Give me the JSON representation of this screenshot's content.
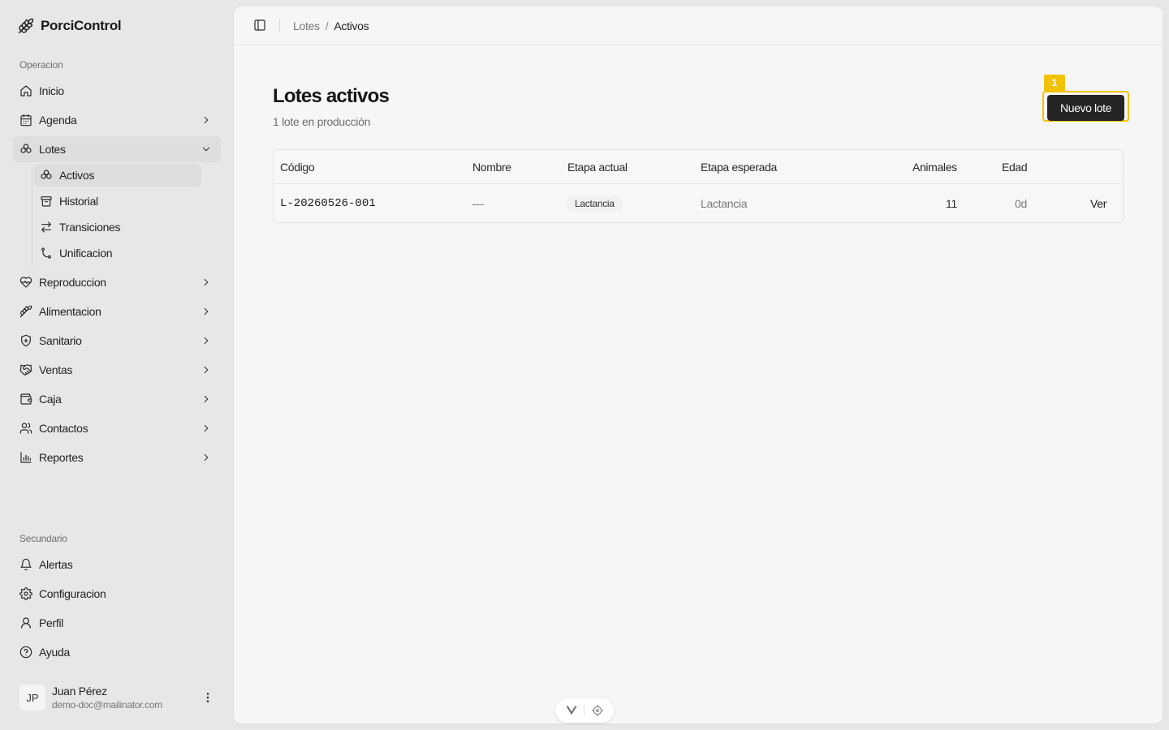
{
  "app": {
    "name": "PorciControl"
  },
  "sidebar": {
    "section_primary": "Operacion",
    "items": [
      {
        "label": "Inicio",
        "icon": "home-icon"
      },
      {
        "label": "Agenda",
        "icon": "calendar-icon"
      },
      {
        "label": "Lotes",
        "icon": "pigs-icon",
        "expanded": true
      },
      {
        "label": "Reproduccion",
        "icon": "heart-pulse-icon"
      },
      {
        "label": "Alimentacion",
        "icon": "wheat-icon"
      },
      {
        "label": "Sanitario",
        "icon": "shield-icon"
      },
      {
        "label": "Ventas",
        "icon": "handshake-icon"
      },
      {
        "label": "Caja",
        "icon": "wallet-icon"
      },
      {
        "label": "Contactos",
        "icon": "users-icon"
      },
      {
        "label": "Reportes",
        "icon": "bar-chart-icon"
      }
    ],
    "lotes_sub": [
      {
        "label": "Activos",
        "icon": "pigs-icon",
        "active": true
      },
      {
        "label": "Historial",
        "icon": "archive-icon"
      },
      {
        "label": "Transiciones",
        "icon": "swap-icon"
      },
      {
        "label": "Unificacion",
        "icon": "merge-icon"
      }
    ],
    "section_secondary": "Secundario",
    "secondary_items": [
      {
        "label": "Alertas",
        "icon": "bell-icon"
      },
      {
        "label": "Configuracion",
        "icon": "gear-icon"
      },
      {
        "label": "Perfil",
        "icon": "user-icon"
      },
      {
        "label": "Ayuda",
        "icon": "help-circle-icon"
      }
    ],
    "user": {
      "initials": "JP",
      "name": "Juan Pérez",
      "email": "demo-doc@mailinator.com"
    }
  },
  "breadcrumb": {
    "parent": "Lotes",
    "separator": "/",
    "current": "Activos"
  },
  "page": {
    "title": "Lotes activos",
    "subtitle": "1 lote en producción",
    "new_button": "Nuevo lote",
    "highlight_badge": "1"
  },
  "table": {
    "headers": [
      "Código",
      "Nombre",
      "Etapa actual",
      "Etapa esperada",
      "Animales",
      "Edad"
    ],
    "rows": [
      {
        "codigo": "L-20260526-001",
        "nombre": "—",
        "etapa_actual": "Lactancia",
        "etapa_esperada": "Lactancia",
        "animales": "11",
        "edad": "0d",
        "action": "Ver"
      }
    ]
  },
  "colors": {
    "highlight": "#f2c200",
    "button_bg": "#242424",
    "sidebar_bg": "#e7e7e5",
    "panel_bg": "#f6f6f6"
  }
}
